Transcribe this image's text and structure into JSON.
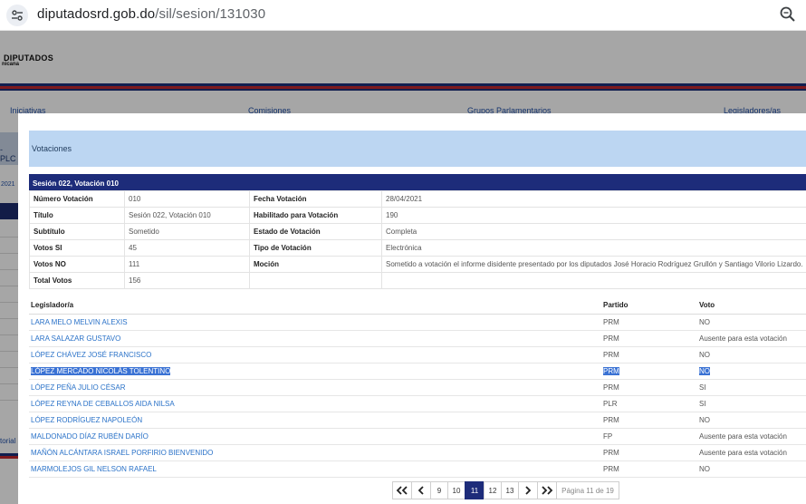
{
  "browser": {
    "url_host": "diputadosrd.gob.do",
    "url_path": "/sil/sesion/131030"
  },
  "site": {
    "logo_main": "DIPUTADOS",
    "logo_sub": "nicana",
    "nav": [
      "Iniciativas",
      "Comisiones",
      "Grupos Parlamentarios",
      "Legisladores/as"
    ],
    "side_label": "-PLC",
    "side_year": "2021",
    "side_footer": "torial"
  },
  "modal": {
    "title": "Votaciones",
    "session_header": "Sesión 022, Votación 010",
    "info_rows": [
      {
        "k1": "Número Votación",
        "v1": "010",
        "k2": "Fecha Votación",
        "v2": "28/04/2021"
      },
      {
        "k1": "Título",
        "v1": "Sesión 022, Votación 010",
        "k2": "Habilitado para Votación",
        "v2": "190"
      },
      {
        "k1": "Subtítulo",
        "v1": "Sometido",
        "k2": "Estado de Votación",
        "v2": "Completa"
      },
      {
        "k1": "Votos SI",
        "v1": "45",
        "k2": "Tipo de Votación",
        "v2": "Electrónica"
      },
      {
        "k1": "Votos NO",
        "v1": "111",
        "k2": "Moción",
        "v2": "Sometido a votación el informe disidente presentado por los diputados José Horacio Rodríguez Grullón y Santiago Vilorio Lizardo."
      },
      {
        "k1": "Total Votos",
        "v1": "156",
        "k2": "",
        "v2": ""
      }
    ],
    "voters_headers": {
      "name": "Legislador/a",
      "party": "Partido",
      "vote": "Voto"
    },
    "voters": [
      {
        "name": "LARA MELO MELVIN ALEXIS",
        "party": "PRM",
        "vote": "NO"
      },
      {
        "name": "LARA SALAZAR GUSTAVO",
        "party": "PRM",
        "vote": "Ausente para esta votación"
      },
      {
        "name": "LÓPEZ CHÁVEZ JOSÉ FRANCISCO",
        "party": "PRM",
        "vote": "NO"
      },
      {
        "name": "LÓPEZ MERCADO NICOLÁS TOLENTINO",
        "party": "PRM",
        "vote": "NO"
      },
      {
        "name": "LÓPEZ PEÑA JULIO CÉSAR",
        "party": "PRM",
        "vote": "SI"
      },
      {
        "name": "LÓPEZ REYNA DE CEBALLOS AIDA NILSA",
        "party": "PLR",
        "vote": "SI"
      },
      {
        "name": "LÓPEZ RODRÍGUEZ NAPOLEÓN",
        "party": "PRM",
        "vote": "NO"
      },
      {
        "name": "MALDONADO DÍAZ RUBÉN DARÍO",
        "party": "FP",
        "vote": "Ausente para esta votación"
      },
      {
        "name": "MAÑÓN ALCÁNTARA ISRAEL PORFIRIO BIENVENIDO",
        "party": "PRM",
        "vote": "Ausente para esta votación"
      },
      {
        "name": "MARMOLEJOS GIL NELSON RAFAEL",
        "party": "PRM",
        "vote": "NO"
      }
    ],
    "pagination": {
      "pages": [
        "9",
        "10",
        "11",
        "12",
        "13"
      ],
      "current": "11",
      "info": "Página 11 de 19"
    }
  }
}
